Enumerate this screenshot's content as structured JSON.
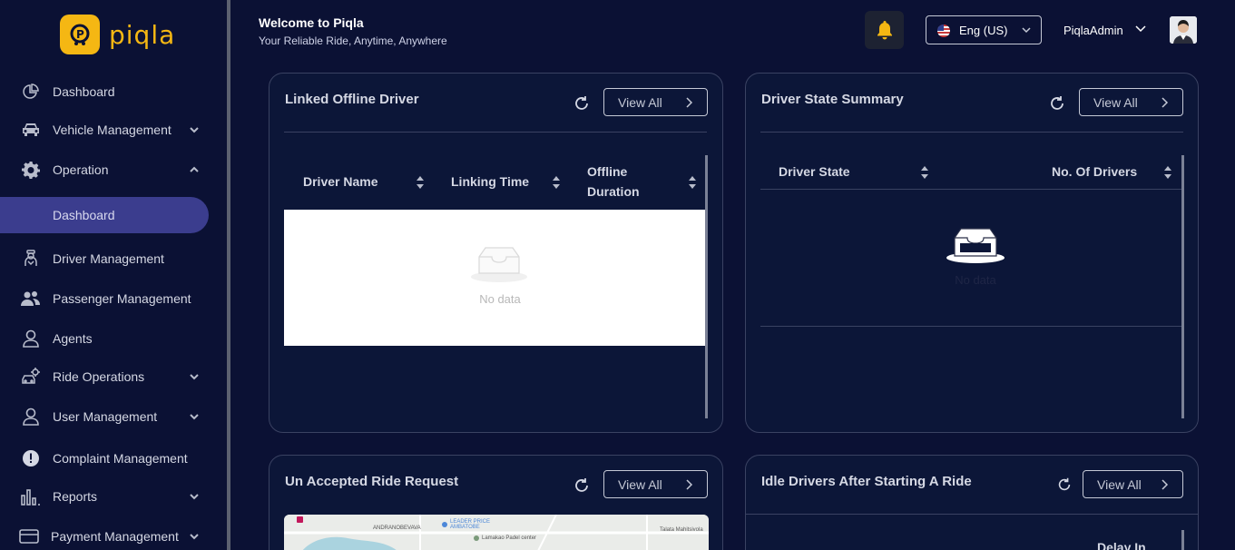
{
  "app": {
    "logo_text": "piqla"
  },
  "sidebar": {
    "items": [
      {
        "label": "Dashboard",
        "icon": "pie-chart-icon"
      },
      {
        "label": "Vehicle Management",
        "icon": "car-icon"
      },
      {
        "label": "Operation",
        "icon": "gear-icon"
      },
      {
        "label": "Dashboard",
        "icon": ""
      },
      {
        "label": "Driver Management",
        "icon": "driver-icon"
      },
      {
        "label": "Passenger Management",
        "icon": "users-icon"
      },
      {
        "label": "Agents",
        "icon": "user-icon"
      },
      {
        "label": "Ride Operations",
        "icon": "ride-gear-icon"
      },
      {
        "label": "User Management",
        "icon": "user-icon"
      },
      {
        "label": "Complaint Management",
        "icon": "alert-icon"
      },
      {
        "label": "Reports",
        "icon": "bar-chart-icon"
      },
      {
        "label": "Payment Management",
        "icon": "card-icon"
      }
    ]
  },
  "header": {
    "title": "Welcome to Piqla",
    "subtitle": "Your Reliable Ride, Anytime, Anywhere",
    "language": "Eng (US)",
    "username": "PiqlaAdmin"
  },
  "cards": {
    "linked_offline": {
      "title": "Linked Offline Driver",
      "view_all": "View All",
      "columns": [
        "Driver Name",
        "Linking Time",
        "Offline",
        "Duration"
      ],
      "empty_text": "No data"
    },
    "driver_state": {
      "title": "Driver State Summary",
      "view_all": "View All",
      "columns": [
        "Driver State",
        "No. Of Drivers"
      ],
      "empty_text": "No data"
    },
    "unaccepted": {
      "title": "Un Accepted Ride Request",
      "view_all": "View All",
      "map_labels": [
        "ANDRANOBEVAVA",
        "LEADER PRICE AMBATOBE",
        "Lamakao Padel center",
        "Talata Mahitsivola"
      ]
    },
    "idle_drivers": {
      "title": "Idle Drivers After Starting A Ride",
      "view_all": "View All",
      "columns": [
        "Delay In"
      ]
    }
  },
  "colors": {
    "background": "#0b1134",
    "card": "#0c1638",
    "accent": "#f5b713",
    "active_nav": "#3b3d8e"
  }
}
